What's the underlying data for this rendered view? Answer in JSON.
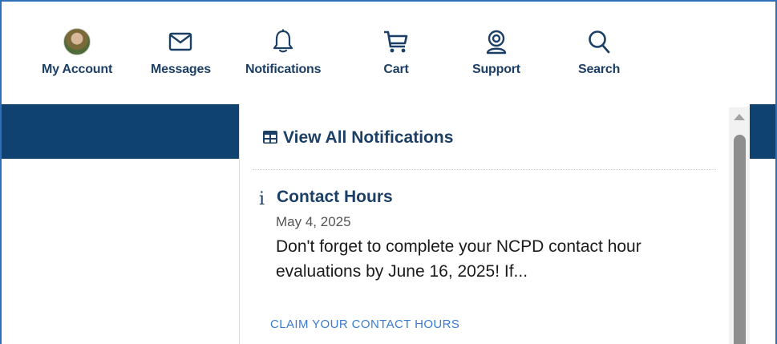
{
  "topnav": {
    "items": [
      {
        "label": "My Account",
        "icon": "avatar"
      },
      {
        "label": "Messages",
        "icon": "envelope-icon"
      },
      {
        "label": "Notifications",
        "icon": "bell-icon"
      },
      {
        "label": "Cart",
        "icon": "cart-icon"
      },
      {
        "label": "Support",
        "icon": "support-icon"
      },
      {
        "label": "Search",
        "icon": "search-icon"
      }
    ]
  },
  "panel": {
    "view_all_label": "View All Notifications",
    "notifications": [
      {
        "icon": "info-icon",
        "title": "Contact Hours",
        "date": "May 4, 2025",
        "body": "Don't forget to complete your NCPD contact hour evaluations by June 16, 2025! If...",
        "action": "CLAIM YOUR CONTACT HOURS"
      }
    ]
  },
  "colors": {
    "brand_navy": "#0f4270",
    "nav_text": "#1c3f66",
    "link": "#3a7bd5",
    "frame_border": "#2f6fb8"
  }
}
